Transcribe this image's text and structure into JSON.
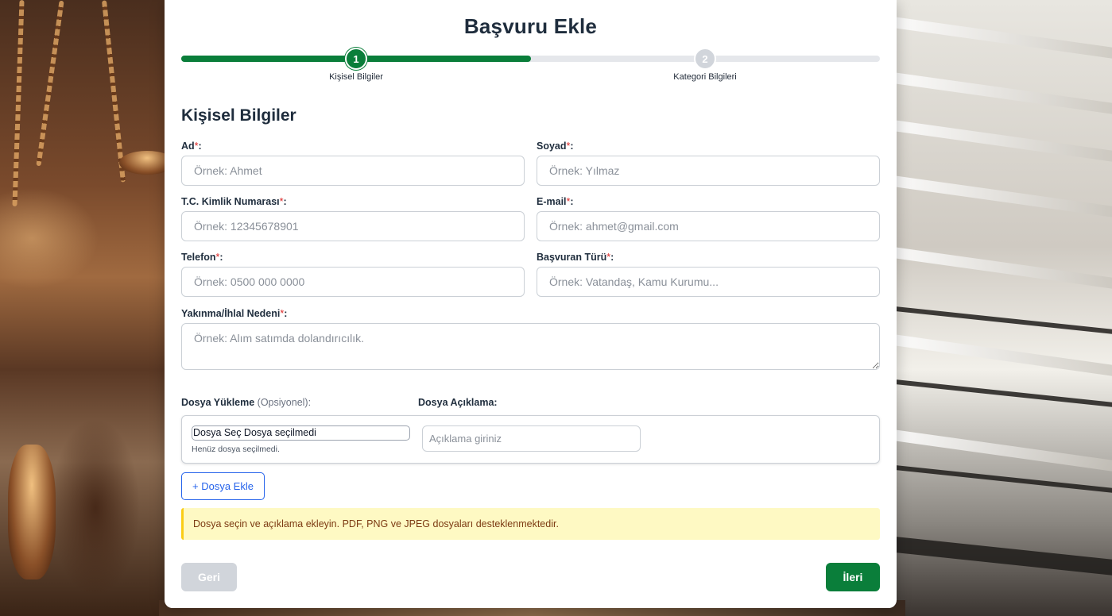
{
  "header": {
    "title": "Başvuru Ekle"
  },
  "stepper": {
    "progress_fraction": 0.5,
    "steps": [
      {
        "number": "1",
        "label": "Kişisel Bilgiler",
        "state": "active"
      },
      {
        "number": "2",
        "label": "Kategori Bilgileri",
        "state": "pending"
      }
    ],
    "active_color": "#0a7e3a",
    "pending_color": "#d1d5db"
  },
  "form": {
    "section_title": "Kişisel Bilgiler",
    "required_mark": "*",
    "label_suffix": ":",
    "fields": {
      "ad": {
        "label": "Ad",
        "placeholder": "Örnek: Ahmet",
        "value": ""
      },
      "soyad": {
        "label": "Soyad",
        "placeholder": "Örnek: Yılmaz",
        "value": ""
      },
      "tc": {
        "label": "T.C. Kimlik Numarası",
        "placeholder": "Örnek: 12345678901",
        "value": ""
      },
      "email": {
        "label": "E-mail",
        "placeholder": "Örnek: ahmet@gmail.com",
        "value": ""
      },
      "telefon": {
        "label": "Telefon",
        "placeholder": "Örnek: 0500 000 0000",
        "value": ""
      },
      "basvuran": {
        "label": "Başvuran Türü",
        "placeholder": "Örnek: Vatandaş, Kamu Kurumu...",
        "value": ""
      },
      "neden": {
        "label": "Yakınma/İhlal Nedeni",
        "placeholder": "Örnek: Alım satımda dolandırıcılık.",
        "value": ""
      }
    }
  },
  "files": {
    "upload_label": "Dosya Yükleme",
    "upload_optional": "(Opsiyonel):",
    "desc_label": "Dosya Açıklama:",
    "picker_text": "Dosya Seç Dosya seçilmedi",
    "hint": "Henüz dosya seçilmedi.",
    "desc_placeholder": "Açıklama giriniz",
    "add_button": "+ Dosya Ekle"
  },
  "notice": {
    "text": "Dosya seçin ve açıklama ekleyin. PDF, PNG ve JPEG dosyaları desteklenmektedir."
  },
  "actions": {
    "back": "Geri",
    "next": "İleri",
    "back_enabled": false
  },
  "colors": {
    "primary": "#0a7e3a",
    "link": "#2563eb",
    "required": "#dc2626",
    "notice_bg": "#fef9c3"
  }
}
